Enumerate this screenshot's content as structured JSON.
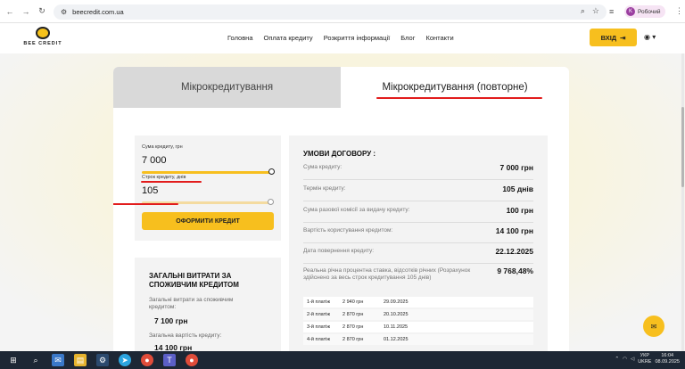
{
  "browser": {
    "url": "beecredit.com.ua",
    "profile_initial": "K",
    "profile_name": "Робочий"
  },
  "header": {
    "logo_text": "BEE CREDIT",
    "nav": [
      "Головна",
      "Оплата кредиту",
      "Розкриття інформації",
      "Блог",
      "Контакти"
    ],
    "login_label": "ВХІД"
  },
  "tabs": {
    "left": "Мікрокредитування",
    "right": "Мікрокредитування (повторне)"
  },
  "calculator": {
    "amount_label": "Сума кредиту, грн",
    "amount_value": "7 000",
    "amount_fill": 1.0,
    "term_label": "Строк кредиту, днів",
    "term_value": "105",
    "term_fill": 1.0,
    "button_label": "ОФОРМИТИ КРЕДИТ"
  },
  "expenses": {
    "title": "ЗАГАЛЬНІ ВИТРАТИ ЗА СПОЖИВЧИМ КРЕДИТОМ",
    "items": [
      {
        "label": "Загальні витрати за споживчим кредитом:",
        "value": "7 100 грн"
      },
      {
        "label": "Загальна вартість кредиту:",
        "value": "14 100 грн"
      }
    ]
  },
  "conditions": {
    "title": "УМОВИ ДОГОВОРУ :",
    "rows": [
      {
        "label": "Сума кредиту:",
        "value": "7 000 грн"
      },
      {
        "label": "Термін кредиту:",
        "value": "105 днів"
      },
      {
        "label": "Сума разової комісії за видачу кредиту:",
        "value": "100 грн"
      },
      {
        "label": "Вартість користування кредитом:",
        "value": "14 100 грн"
      },
      {
        "label": "Дата повернення кредиту:",
        "value": "22.12.2025"
      },
      {
        "label": "Реальна річна процентна ставка, відсотків річних (Розрахунок здійснено за весь строк кредитування 105 днів)",
        "value": "9 768,48%"
      }
    ],
    "payments": [
      {
        "n": "1-й платіж",
        "amount": "2 940 грн",
        "date": "29.09.2025"
      },
      {
        "n": "2-й платіж",
        "amount": "2 870 грн",
        "date": "20.10.2025"
      },
      {
        "n": "3-й платіж",
        "amount": "2 870 грн",
        "date": "10.11.2025"
      },
      {
        "n": "4-й платіж",
        "amount": "2 870 грн",
        "date": "01.12.2025"
      }
    ]
  },
  "taskbar": {
    "lang": "УКР",
    "lang2": "UKRE",
    "time": "16:04",
    "date": "08.09.2025"
  },
  "colors": {
    "accent": "#f7bf1e",
    "highlight_red": "#e21c1c",
    "taskbar": "#1d2735"
  }
}
